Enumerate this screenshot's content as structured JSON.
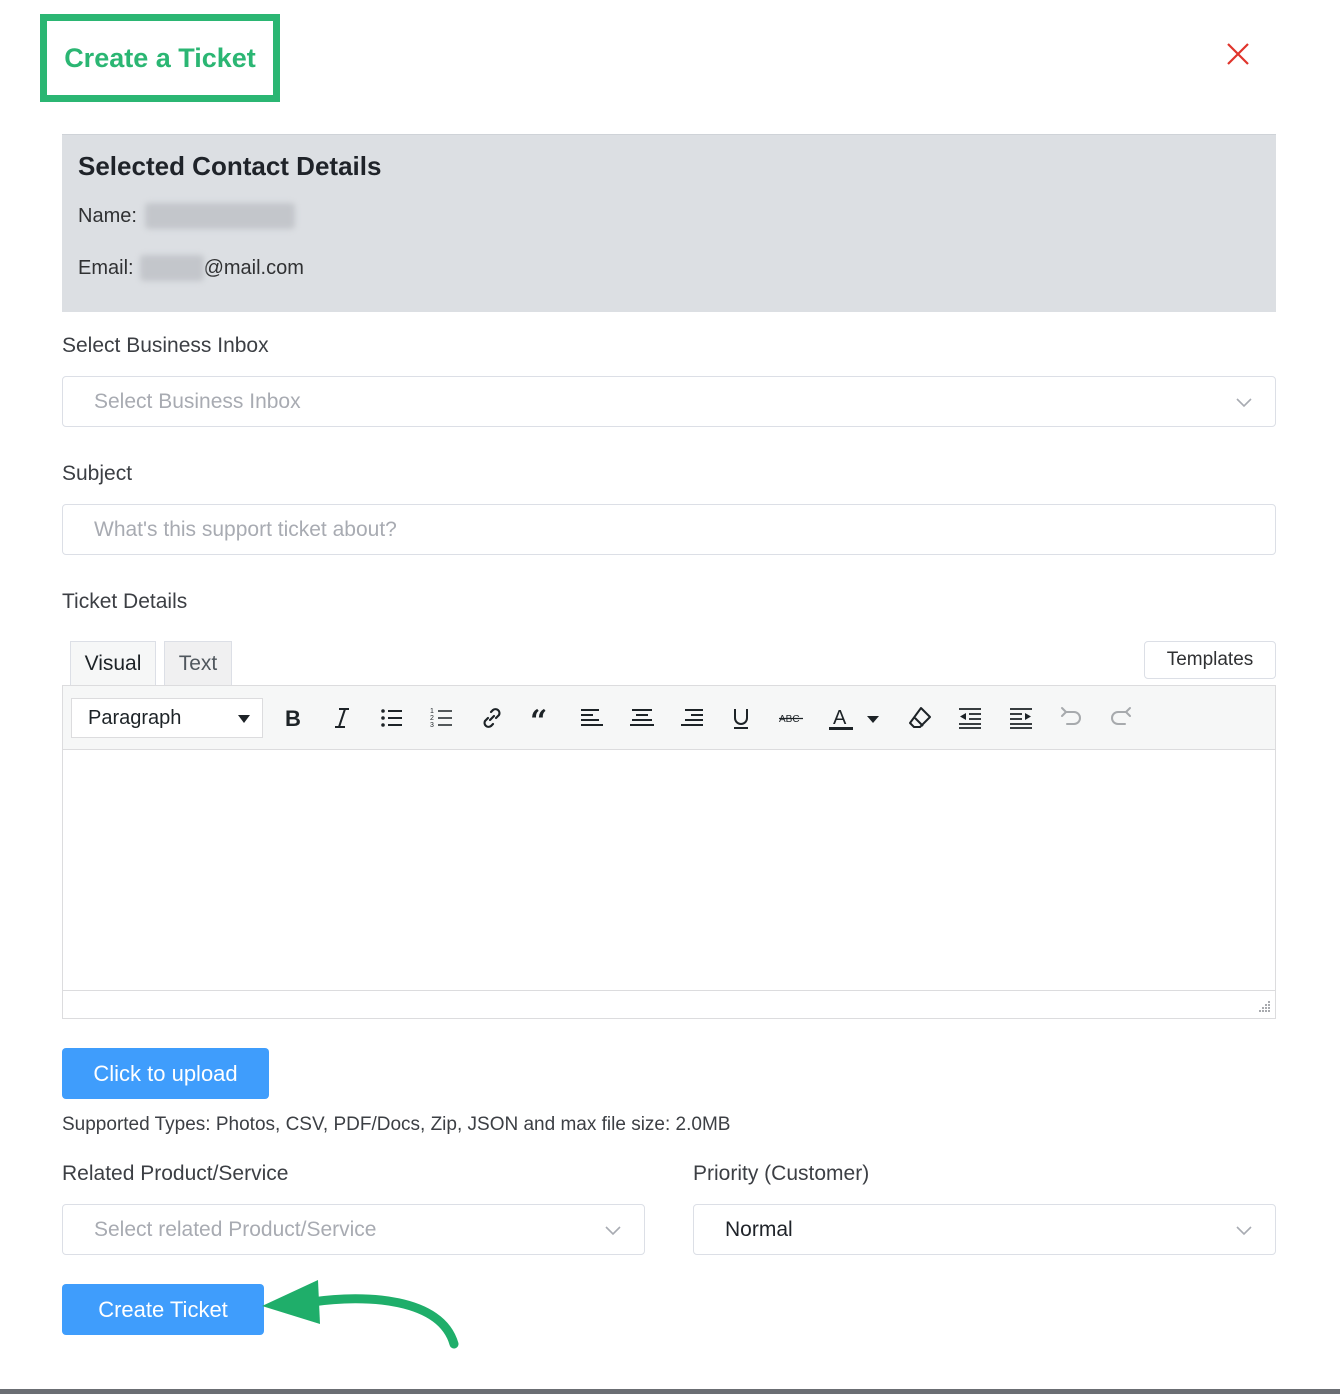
{
  "header": {
    "title": "Create a Ticket"
  },
  "contact": {
    "title": "Selected Contact Details",
    "name_label": "Name:",
    "email_label": "Email:",
    "email_domain": "@mail.com"
  },
  "inbox": {
    "label": "Select Business Inbox",
    "placeholder": "Select Business Inbox"
  },
  "subject": {
    "label": "Subject",
    "placeholder": "What's this support ticket about?"
  },
  "details": {
    "label": "Ticket Details",
    "tabs": [
      "Visual",
      "Text"
    ],
    "templates_label": "Templates",
    "format_value": "Paragraph",
    "toolbar_icons": [
      "bold-icon",
      "italic-icon",
      "bullet-list-icon",
      "numbered-list-icon",
      "link-icon",
      "blockquote-icon",
      "align-left-icon",
      "align-center-icon",
      "align-right-icon",
      "underline-icon",
      "strikethrough-icon",
      "text-color-icon",
      "clear-formatting-icon",
      "outdent-icon",
      "indent-icon",
      "undo-icon",
      "redo-icon"
    ]
  },
  "upload": {
    "button_label": "Click to upload",
    "hint": "Supported Types: Photos, CSV, PDF/Docs, Zip, JSON and max file size: 2.0MB"
  },
  "product": {
    "label": "Related Product/Service",
    "placeholder": "Select related Product/Service"
  },
  "priority": {
    "label": "Priority (Customer)",
    "value": "Normal"
  },
  "submit": {
    "label": "Create Ticket"
  },
  "colors": {
    "accent_green": "#2bb673",
    "primary_blue": "#3f9dfc",
    "close_red": "#e0342b",
    "panel_gray": "#dcdfe3"
  }
}
